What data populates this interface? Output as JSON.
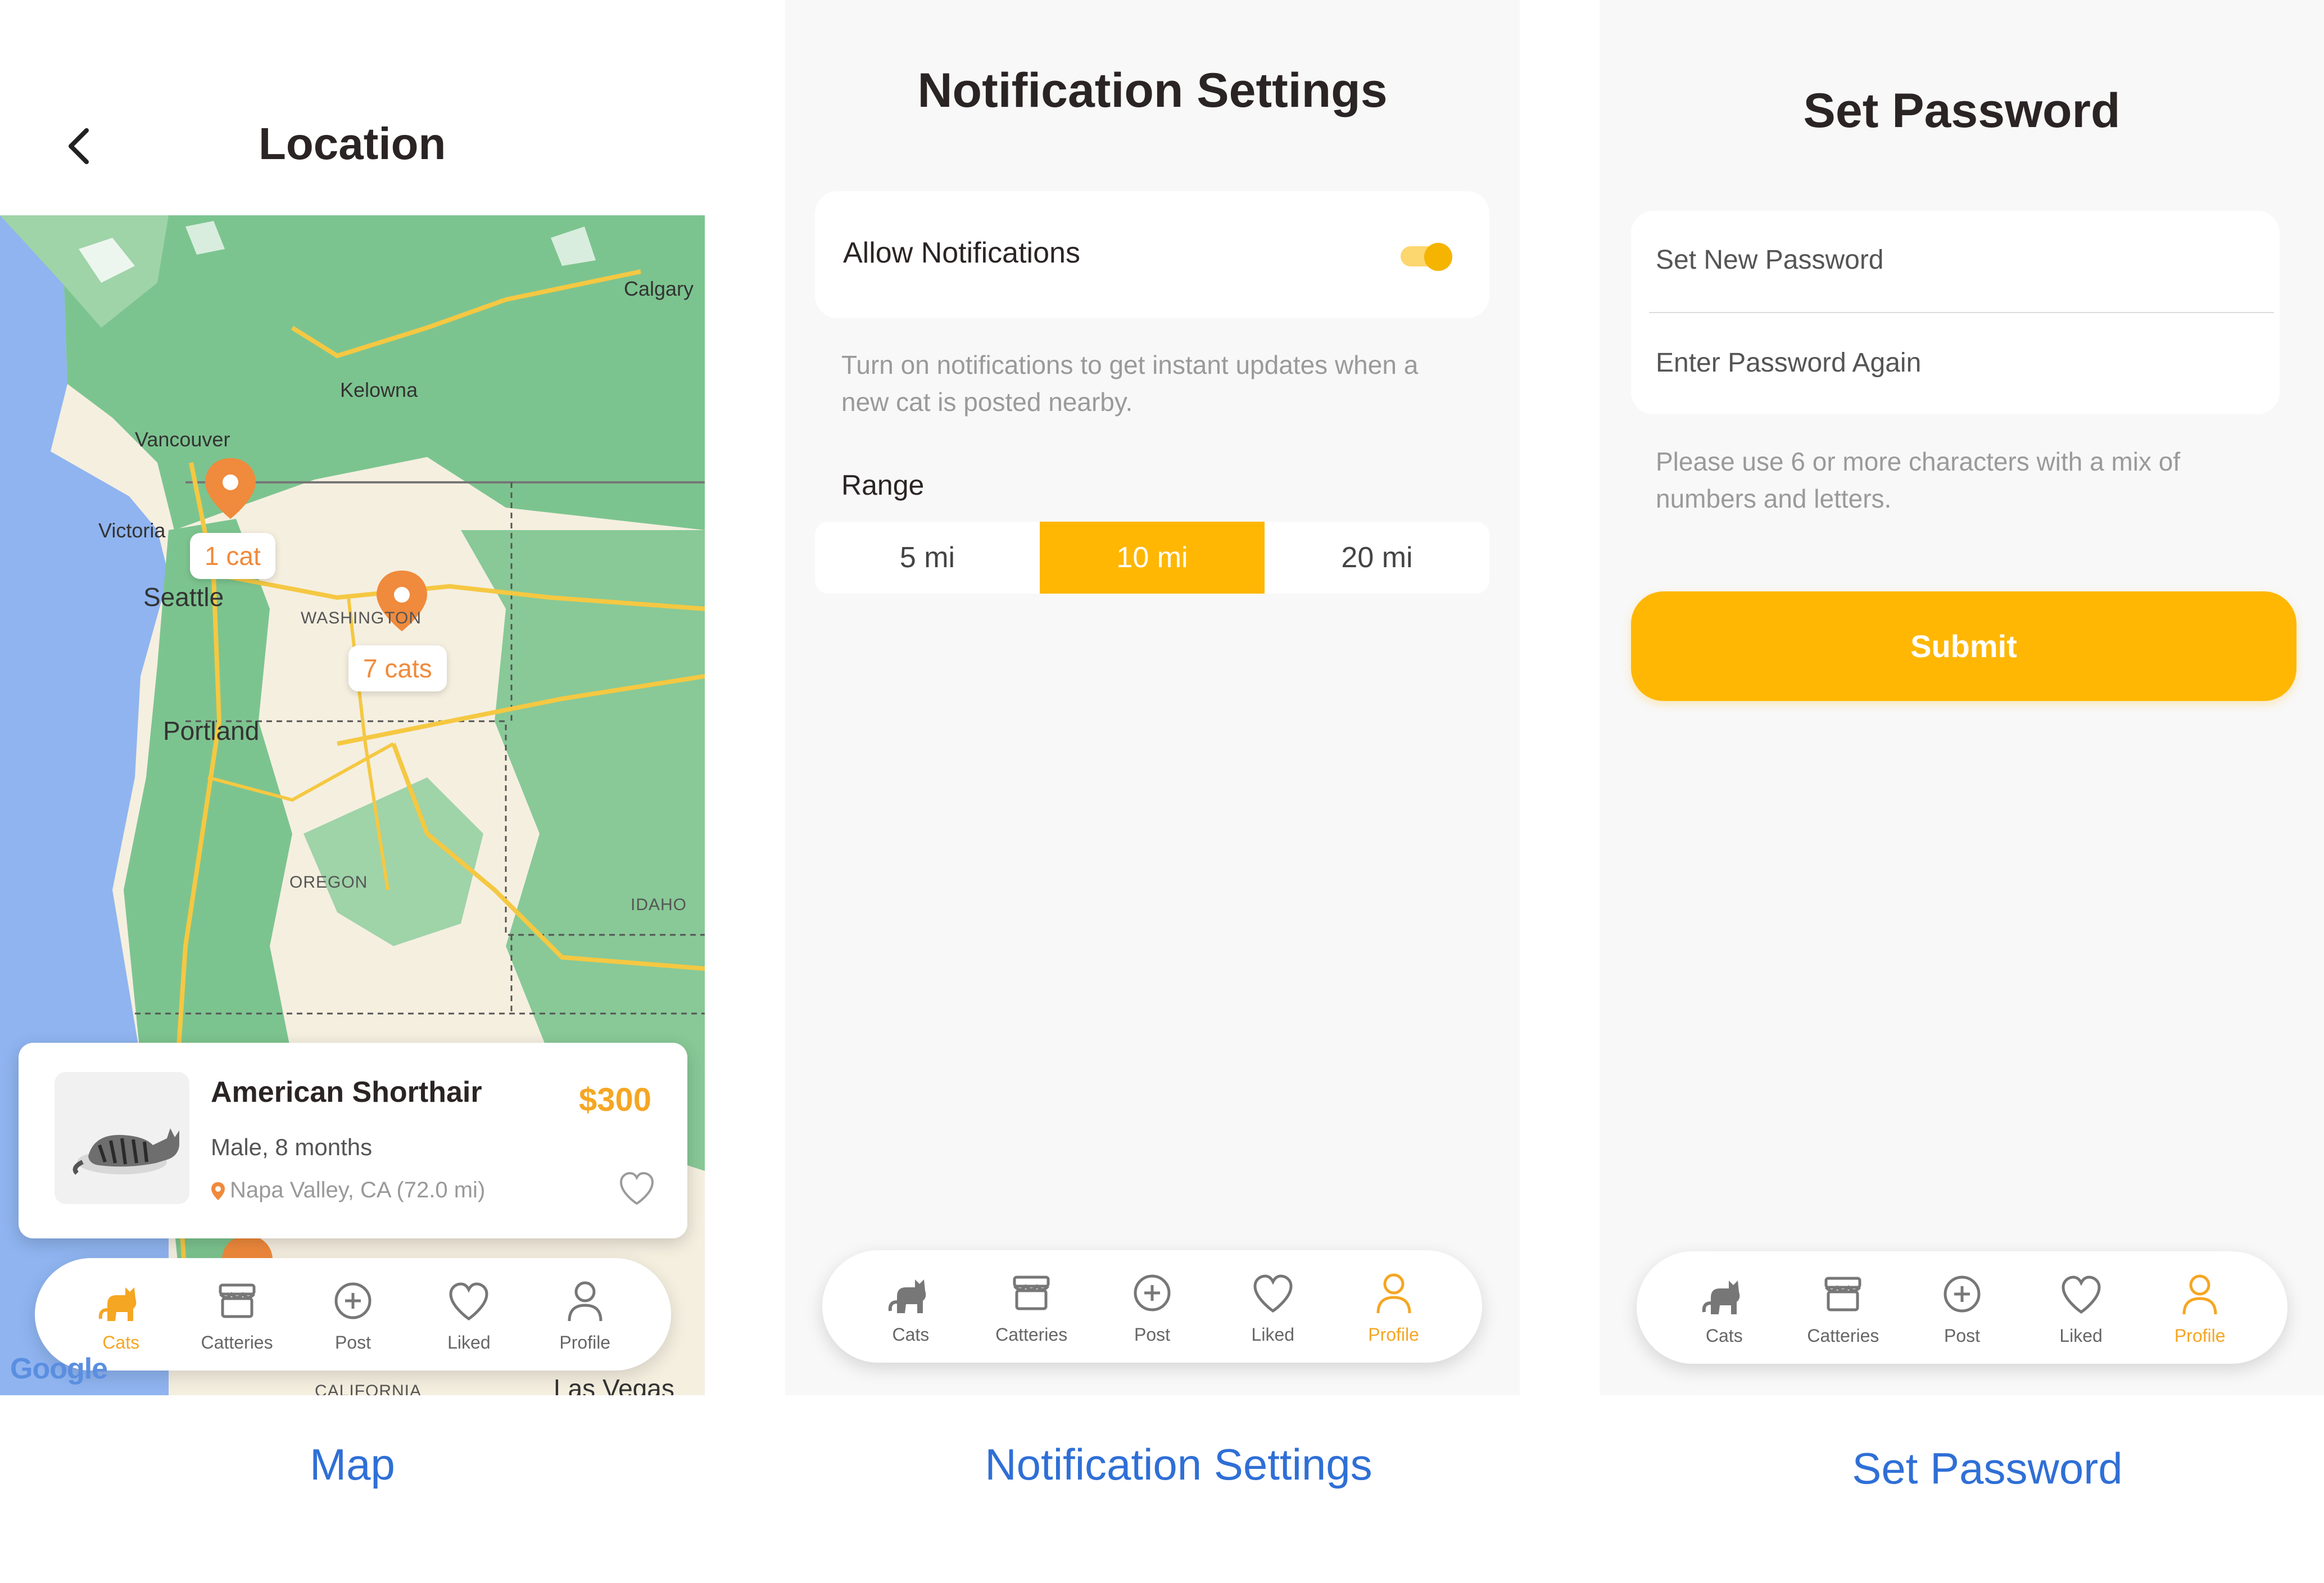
{
  "map_screen": {
    "title": "Location",
    "cities": {
      "calgary": "Calgary",
      "kelowna": "Kelowna",
      "vancouver": "Vancouver",
      "victoria": "Victoria",
      "seattle": "Seattle",
      "portland": "Portland",
      "las_vegas": "Las Vegas"
    },
    "regions": {
      "washington": "WASHINGTON",
      "oregon": "OREGON",
      "idaho": "IDAHO",
      "california": "CALIFORNIA"
    },
    "pins": [
      {
        "label": "1 cat"
      },
      {
        "label": "7 cats"
      }
    ],
    "attribution": "Google",
    "card": {
      "name": "American Shorthair",
      "price": "$300",
      "details": "Male, 8 months",
      "location": "Napa Valley, CA (72.0 mi)"
    },
    "caption": "Map"
  },
  "tabs": [
    {
      "label": "Cats",
      "icon": "cat-icon"
    },
    {
      "label": "Catteries",
      "icon": "store-icon"
    },
    {
      "label": "Post",
      "icon": "plus-circle-icon"
    },
    {
      "label": "Liked",
      "icon": "heart-icon"
    },
    {
      "label": "Profile",
      "icon": "user-icon"
    }
  ],
  "notification_screen": {
    "title": "Notification Settings",
    "allow_label": "Allow Notifications",
    "allow_enabled": true,
    "hint": "Turn on notifications to get instant updates when a new cat is posted nearby.",
    "range_label": "Range",
    "range_options": [
      "5 mi",
      "10 mi",
      "20 mi"
    ],
    "range_selected": "10 mi",
    "active_tab": "Profile",
    "caption": "Notification Settings"
  },
  "password_screen": {
    "title": "Set Password",
    "new_password_placeholder": "Set New Password",
    "confirm_password_placeholder": "Enter Password Again",
    "hint": "Please use 6 or more characters with a mix of numbers and letters.",
    "submit_label": "Submit",
    "active_tab": "Profile",
    "caption": "Set Password"
  },
  "colors": {
    "accent": "#ffb703",
    "pin": "#f08a3c",
    "caption": "#2f6fd6",
    "map_water": "#8fb4f0",
    "map_land": "#f5efe0",
    "map_forest": "#7cc48f"
  }
}
